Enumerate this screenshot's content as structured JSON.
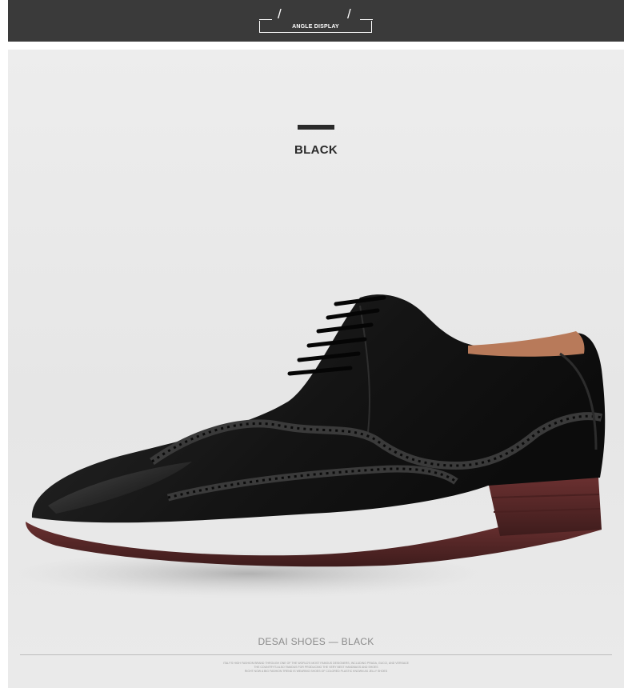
{
  "header": {
    "label": "ANGLE DISPLAY",
    "slash_left": "/",
    "slash_right": "/"
  },
  "product": {
    "color_name": "BLACK",
    "caption": "DESAI SHOES — BLACK",
    "fine_print": [
      "ITALY'S HIGH FASHION BRAND THROUGH ONE OF THE WORLD'S MOST FAMOUS DESIGNERS, INCLUDING PRADA, GUCCI, AND VERSACE",
      "THE COUNTRY'S ALSO FAMOUS FOR PRODUCING THE VERY BEST HANDBAGS AND SHOES",
      "RIGHT NOW A BIG FASHION TREND IS WEARING SHOES OF COLORED PLASTIC KNOWN AS JELLY SHOES"
    ]
  },
  "colors": {
    "header_bg": "#3a3a3a",
    "photo_bg": "#e8e8e8",
    "leather": "#1a1a1a",
    "sole": "#5a2a2a",
    "lining": "#b87a5a"
  },
  "icons": [
    "angle-display-frame-icon",
    "color-swatch-icon"
  ]
}
